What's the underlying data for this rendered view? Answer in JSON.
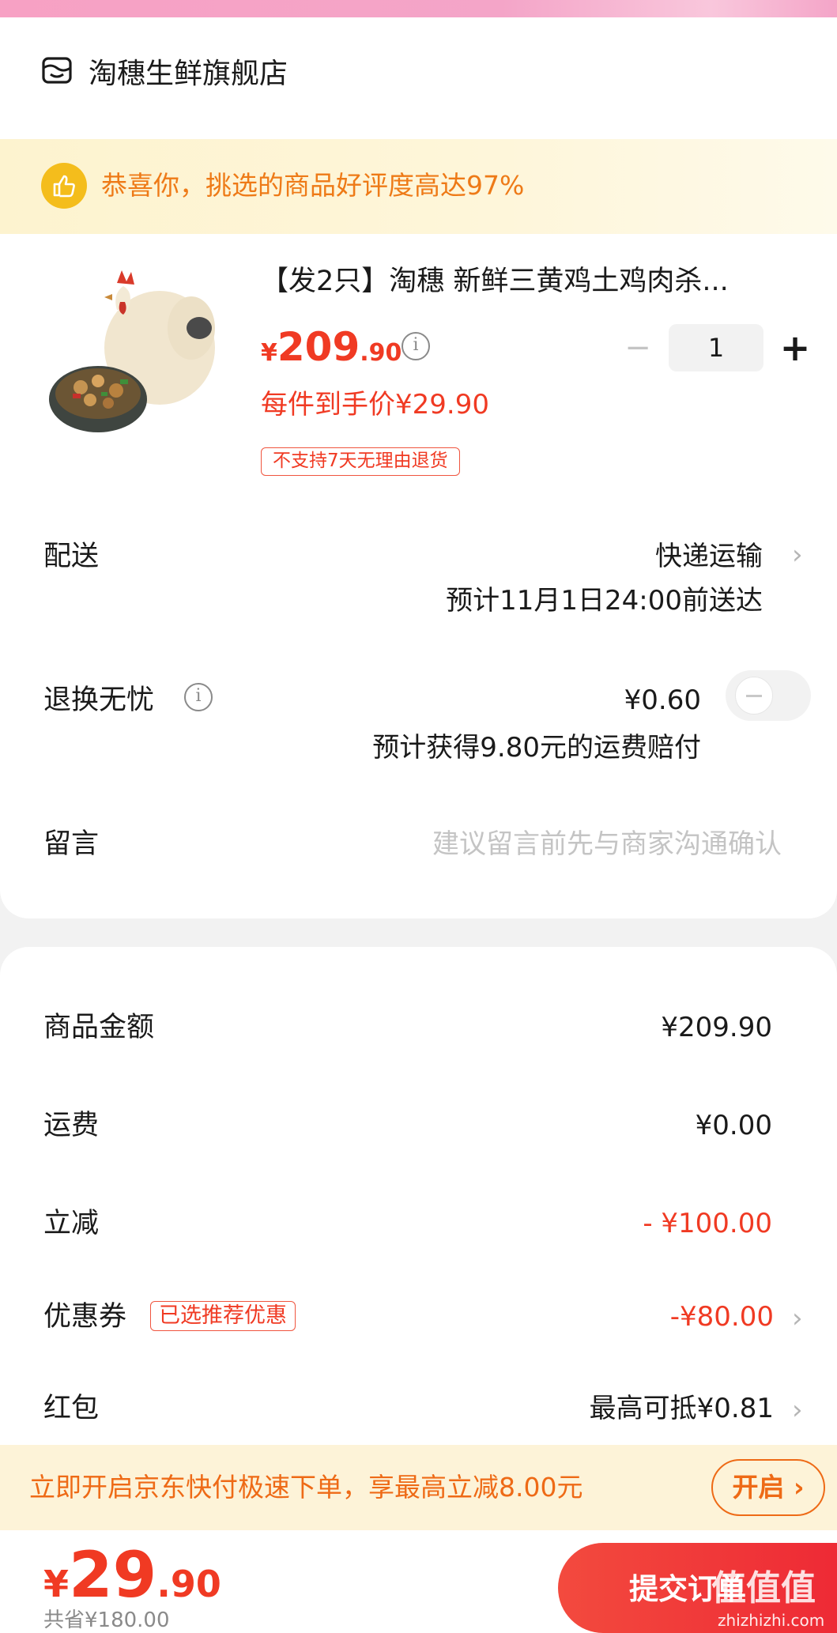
{
  "store": {
    "name": "淘穗生鲜旗舰店",
    "icon": "store-icon"
  },
  "banner": {
    "text": "恭喜你，挑选的商品好评度高达97%",
    "icon": "thumbs-up-icon"
  },
  "product": {
    "title": "【发2只】淘穗 新鲜三黄鸡土鸡肉杀...",
    "price_symbol": "¥",
    "price_int": "209",
    "price_dec": ".90",
    "unit_price": "每件到手价¥29.90",
    "no_return": "不支持7天无理由退货",
    "quantity": "1",
    "minus": "−",
    "plus": "+"
  },
  "delivery": {
    "label": "配送",
    "method": "快递运输",
    "eta": "预计11月1日24:00前送达"
  },
  "return_worry": {
    "label": "退换无忧",
    "price": "¥0.60",
    "note": "预计获得9.80元的运费赔付",
    "toggle_on": false
  },
  "message": {
    "label": "留言",
    "placeholder": "建议留言前先与商家沟通确认"
  },
  "summary": {
    "goods_label": "商品金额",
    "goods_value": "¥209.90",
    "shipping_label": "运费",
    "shipping_value": "¥0.00",
    "discount_label": "立减",
    "discount_value": "- ¥100.00",
    "coupon_label": "优惠券",
    "coupon_tag": "已选推荐优惠",
    "coupon_value": "-¥80.00",
    "redpack_label": "红包",
    "redpack_value": "最高可抵¥0.81"
  },
  "promo": {
    "text": "立即开启京东快付极速下单，享最高立减8.00元",
    "button": "开启 ›"
  },
  "footer": {
    "total_symbol": "¥",
    "total_int": "29",
    "total_dec": ".90",
    "saved": "共省¥180.00",
    "submit": "提交订单",
    "watermark": "值值值",
    "watermark_sub": "zhizhizhi.com"
  },
  "colors": {
    "accent_red": "#f03a23",
    "promo_orange": "#ee6a16",
    "banner_orange": "#ee7a17"
  }
}
